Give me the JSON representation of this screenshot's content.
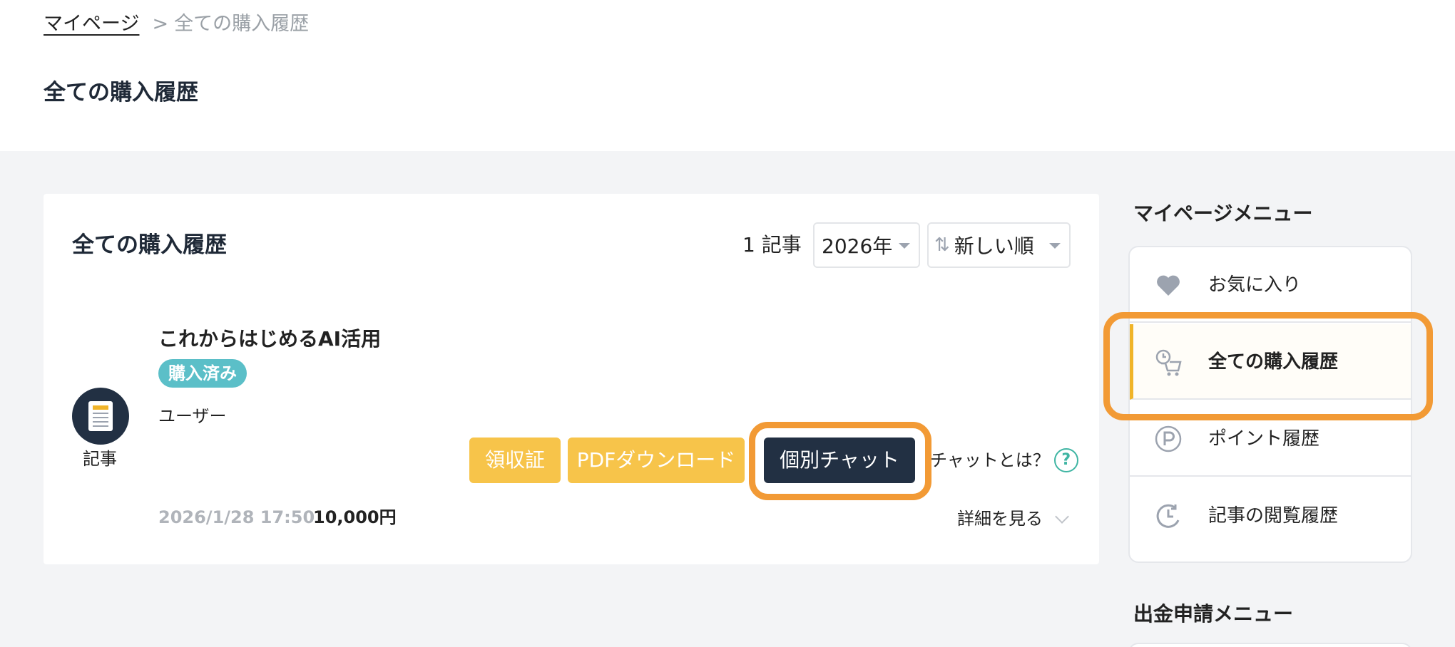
{
  "breadcrumb": {
    "home": "マイページ",
    "separator": ">",
    "current": "全ての購入履歴"
  },
  "page_title": "全ての購入履歴",
  "card": {
    "title": "全ての購入履歴",
    "count": "1 記事",
    "year_select": {
      "selected": "2026年"
    },
    "sort_select": {
      "selected": "新しい順",
      "icon": "sort-arrows-icon"
    },
    "item": {
      "type_label": "記事",
      "type_icon": "document-icon",
      "title": "これからはじめるAI活用",
      "badge": "購入済み",
      "author": "ユーザー",
      "buttons": {
        "receipt": "領収証",
        "pdf": "PDFダウンロード",
        "chat": "個別チャット"
      },
      "chat_help": "チャットとは？",
      "datetime": "2026/1/28 17:50",
      "price": "10,000円",
      "details": "詳細を見る"
    }
  },
  "sidebar": {
    "menu_title": "マイページメニュー",
    "items": [
      {
        "label": "お気に入り",
        "icon": "heart-icon",
        "active": false
      },
      {
        "label": "全ての購入履歴",
        "icon": "cart-history-icon",
        "active": true
      },
      {
        "label": "ポイント履歴",
        "icon": "point-icon",
        "active": false
      },
      {
        "label": "記事の閲覧履歴",
        "icon": "clock-history-icon",
        "active": false
      }
    ],
    "withdrawal_title": "出金申請メニュー"
  },
  "colors": {
    "accent_yellow": "#f7c44a",
    "highlight_orange": "#f29a35",
    "navy": "#223043",
    "badge_teal": "#5bbfc8",
    "help_green": "#3fb5a3",
    "background_gray": "#f3f4f6"
  }
}
